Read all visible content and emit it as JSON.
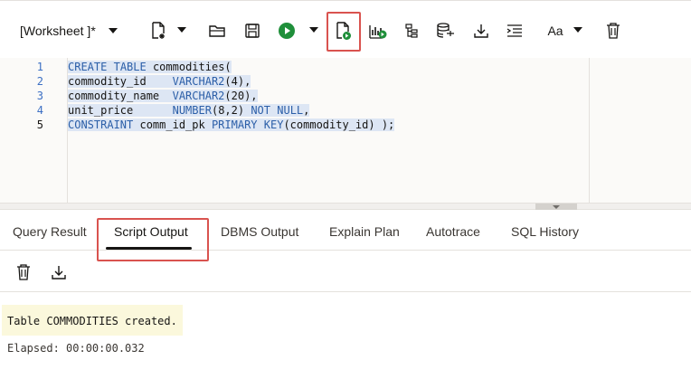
{
  "toolbar": {
    "worksheet_label": "[Worksheet ]*",
    "font_button_label": "Aa",
    "icons": [
      "new-worksheet-icon",
      "open-icon",
      "save-icon",
      "run-statement-icon",
      "run-script-icon",
      "explain-plan-icon",
      "autotrace-icon",
      "database-icon",
      "download-icon",
      "format-icon",
      "font-icon",
      "trash-icon"
    ],
    "highlight_color": "#d9534f",
    "run_color": "#1f8f3a"
  },
  "editor": {
    "line_numbers": [
      "1",
      "2",
      "3",
      "4",
      "5"
    ],
    "lines": [
      {
        "a": "CREATE",
        "b": " ",
        "c": "TABLE",
        "d": " commodities("
      },
      {
        "a": "commodity_id",
        "b": "    ",
        "c": "VARCHAR2",
        "d": "(4),"
      },
      {
        "a": "commodity_name",
        "b": "  ",
        "c": "VARCHAR2",
        "d": "(20),"
      },
      {
        "a": "unit_price",
        "b": "      ",
        "c": "NUMBER",
        "d": "(8,2) ",
        "e": "NOT",
        "f": " ",
        "g": "NULL",
        "h": ","
      },
      {
        "a": "CONSTRAINT",
        "b": " comm_id_pk ",
        "c": "PRIMARY",
        "d": " ",
        "e": "KEY",
        "f": "(commodity_id) );"
      }
    ]
  },
  "tabs": {
    "items": [
      "Query Result",
      "Script Output",
      "DBMS Output",
      "Explain Plan",
      "Autotrace",
      "SQL History"
    ],
    "active": "Script Output"
  },
  "output": {
    "message": "Table COMMODITIES created.",
    "elapsed": "Elapsed: 00:00:00.032",
    "message_bg": "#fbf8dc"
  }
}
